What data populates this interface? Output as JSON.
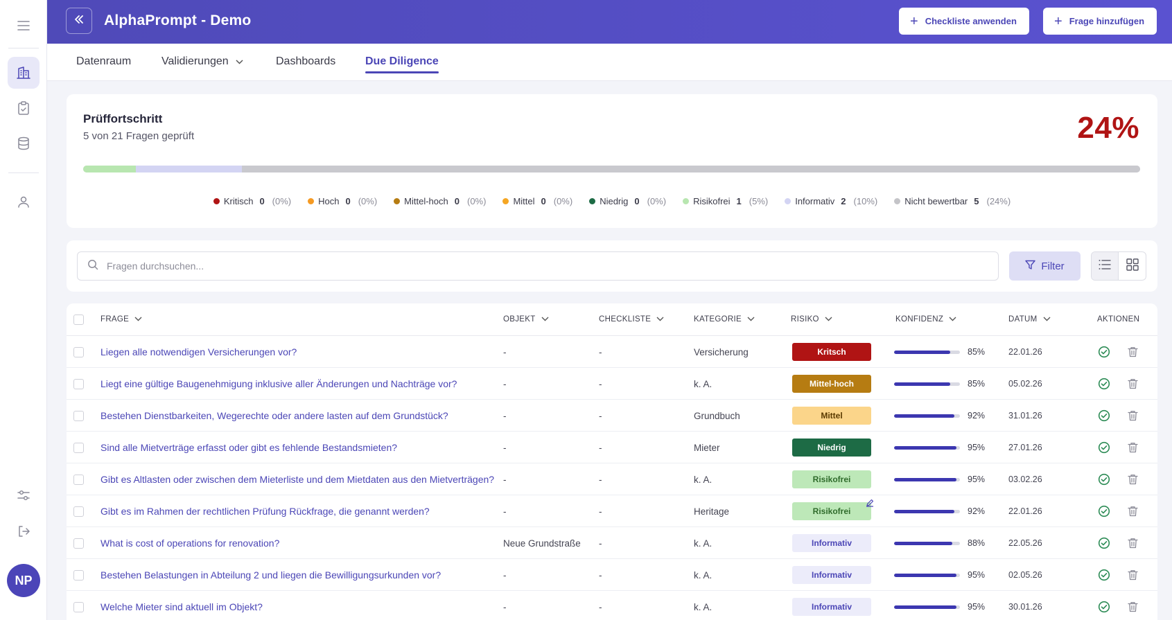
{
  "app": {
    "title": "AlphaPrompt - Demo",
    "user_initials": "NP"
  },
  "header": {
    "apply_checklist": "Checkliste anwenden",
    "add_question": "Frage hinzufügen"
  },
  "tabs": [
    {
      "label": "Datenraum",
      "active": false
    },
    {
      "label": "Validierungen",
      "active": false
    },
    {
      "label": "Dashboards",
      "active": false
    },
    {
      "label": "Due Diligence",
      "active": true
    }
  ],
  "progress": {
    "title": "Prüffortschritt",
    "subtitle": "5 von 21 Fragen geprüft",
    "percent_label": "24%",
    "fill_fraction": 0.24,
    "legend": [
      {
        "label": "Kritisch",
        "count": "0",
        "pct": "(0%)",
        "color": "#b01414"
      },
      {
        "label": "Hoch",
        "count": "0",
        "pct": "(0%)",
        "color": "#f59a23"
      },
      {
        "label": "Mittel-hoch",
        "count": "0",
        "pct": "(0%)",
        "color": "#b67c12"
      },
      {
        "label": "Mittel",
        "count": "0",
        "pct": "(0%)",
        "color": "#f5a623"
      },
      {
        "label": "Niedrig",
        "count": "0",
        "pct": "(0%)",
        "color": "#1d6b45"
      },
      {
        "label": "Risikofrei",
        "count": "1",
        "pct": "(5%)",
        "color": "#b8e6b0"
      },
      {
        "label": "Informativ",
        "count": "2",
        "pct": "(10%)",
        "color": "#d3d4f3"
      },
      {
        "label": "Nicht bewertbar",
        "count": "5",
        "pct": "(24%)",
        "color": "#c4c4c8"
      }
    ],
    "bar_segments": [
      {
        "fraction": 0.05,
        "color": "#b8e6b0"
      },
      {
        "fraction": 0.1,
        "color": "#d3d4f3"
      },
      {
        "fraction": 0.85,
        "color": "#c9c9ce"
      }
    ]
  },
  "search": {
    "placeholder": "Fragen durchsuchen...",
    "value": ""
  },
  "filter": {
    "label": "Filter"
  },
  "table": {
    "columns": [
      "FRAGE",
      "OBJEKT",
      "CHECKLISTE",
      "KATEGORIE",
      "RISIKO",
      "KONFIDENZ",
      "DATUM",
      "AKTIONEN"
    ],
    "rows": [
      {
        "frage": "Liegen alle notwendigen Versicherungen vor?",
        "objekt": "-",
        "checkliste": "-",
        "kategorie": "Versicherung",
        "risiko": "Kritsch",
        "konfidenz": 0.85,
        "konfidenz_label": "85%",
        "datum": "22.01.26"
      },
      {
        "frage": "Liegt eine gültige Baugenehmigung inklusive aller Änderungen und Nachträge vor?",
        "objekt": "-",
        "checkliste": "-",
        "kategorie": "k. A.",
        "risiko": "Mittel-hoch",
        "konfidenz": 0.85,
        "konfidenz_label": "85%",
        "datum": "05.02.26"
      },
      {
        "frage": "Bestehen Dienstbarkeiten, Wegerechte oder andere lasten auf dem Grundstück?",
        "objekt": "-",
        "checkliste": "-",
        "kategorie": "Grundbuch",
        "risiko": "Mittel",
        "konfidenz": 0.92,
        "konfidenz_label": "92%",
        "datum": "31.01.26"
      },
      {
        "frage": "Sind alle Mietverträge erfasst oder gibt es fehlende Bestandsmieten?",
        "objekt": "-",
        "checkliste": "-",
        "kategorie": "Mieter",
        "risiko": "Niedrig",
        "konfidenz": 0.95,
        "konfidenz_label": "95%",
        "datum": "27.01.26"
      },
      {
        "frage": "Gibt es Altlasten oder zwischen dem Mieterliste und dem Mietdaten aus den Mietverträgen?",
        "objekt": "-",
        "checkliste": "-",
        "kategorie": "k. A.",
        "risiko": "Risikofrei",
        "konfidenz": 0.95,
        "konfidenz_label": "95%",
        "datum": "03.02.26"
      },
      {
        "frage": "Gibt es im Rahmen der rechtlichen Prüfung Rückfrage, die genannt werden?",
        "objekt": "-",
        "checkliste": "-",
        "kategorie": "Heritage",
        "risiko": "Risikofrei",
        "konfidenz": 0.92,
        "konfidenz_label": "92%",
        "datum": "22.01.26",
        "edited": true
      },
      {
        "frage": "What is cost of operations for renovation?",
        "objekt": "Neue Grundstraße",
        "checkliste": "-",
        "kategorie": "k. A.",
        "risiko": "Informativ",
        "konfidenz": 0.88,
        "konfidenz_label": "88%",
        "datum": "22.05.26"
      },
      {
        "frage": "Bestehen Belastungen in Abteilung 2 und liegen die Bewilligungsurkunden vor?",
        "objekt": "-",
        "checkliste": "-",
        "kategorie": "k. A.",
        "risiko": "Informativ",
        "konfidenz": 0.95,
        "konfidenz_label": "95%",
        "datum": "02.05.26"
      },
      {
        "frage": "Welche Mieter sind aktuell im Objekt?",
        "objekt": "-",
        "checkliste": "-",
        "kategorie": "k. A.",
        "risiko": "Informativ",
        "konfidenz": 0.95,
        "konfidenz_label": "95%",
        "datum": "30.01.26"
      }
    ]
  },
  "risk_styles": {
    "Kritsch": {
      "bg": "#b01414",
      "fg": "#ffffff"
    },
    "Mittel-hoch": {
      "bg": "#b67c12",
      "fg": "#ffffff"
    },
    "Mittel": {
      "bg": "#fbd58a",
      "fg": "#5a3a00"
    },
    "Niedrig": {
      "bg": "#1d6b45",
      "fg": "#ffffff"
    },
    "Risikofrei": {
      "bg": "#bde8b8",
      "fg": "#2f6b2b"
    },
    "Informativ": {
      "bg": "#ececfa",
      "fg": "#4b46b6"
    }
  },
  "colors": {
    "accent": "#4b46b6",
    "header_bg": "#5550c4",
    "percent": "#b01414",
    "success": "#2c8b55"
  },
  "icons": [
    "menu-icon",
    "building-icon",
    "clipboard-check-icon",
    "database-icon",
    "user-icon",
    "sliders-icon",
    "logout-icon",
    "double-chevron-left-icon",
    "plus-icon",
    "chevron-down-icon",
    "search-icon",
    "filter-icon",
    "list-view-icon",
    "grid-view-icon",
    "check-circle-icon",
    "trash-icon",
    "pencil-icon"
  ]
}
